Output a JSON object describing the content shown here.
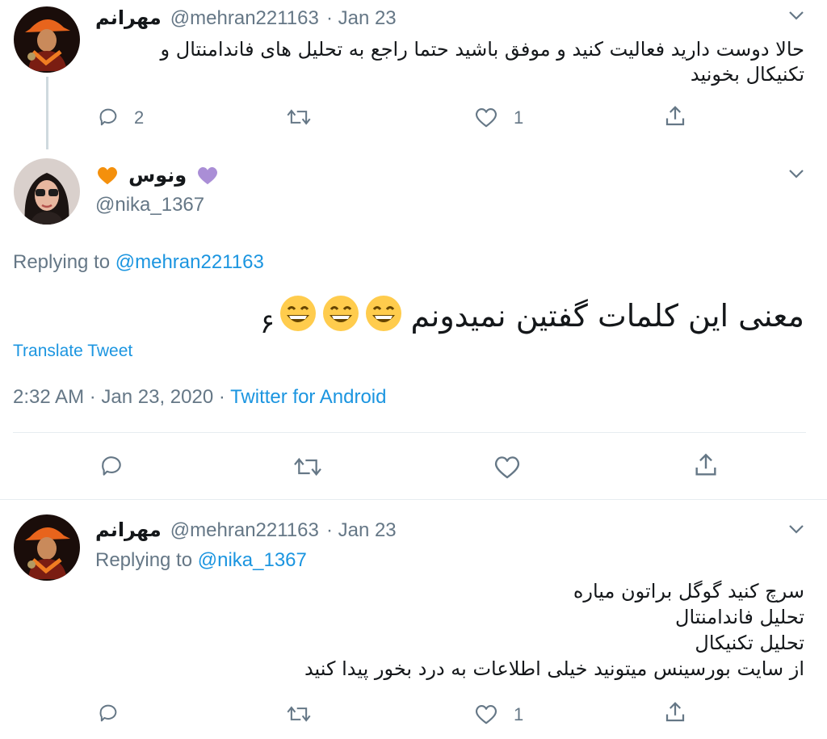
{
  "tweet1": {
    "name": "مهرانم",
    "handle": "@mehran221163",
    "date": "· Jan 23",
    "lines": [
      "حالا دوست دارید فعالیت کنید و موفق باشید حتما راجع به تحلیل های فاندامنتال و",
      "تکنیکال بخونید"
    ],
    "reply_count": "2",
    "like_count": "1"
  },
  "tweet2": {
    "name": "ونوس",
    "handle": "@nika_1367",
    "replying_prefix": "Replying to ",
    "replying_to": "@mehran221163",
    "text": "معنی این کلمات گفتین نمیدونم",
    "trailing": "۶",
    "translate": "Translate Tweet",
    "time": "2:32 AM · Jan 23, 2020 · ",
    "source": "Twitter for Android"
  },
  "tweet3": {
    "name": "مهرانم",
    "handle": "@mehran221163",
    "date": "· Jan 23",
    "replying_prefix": "Replying to ",
    "replying_to": "@nika_1367",
    "lines": [
      "سرچ کنید گوگل براتون میاره",
      "تحلیل فاندامنتال",
      "تحلیل تکنیکال",
      "از سایت بورسینس میتونید خیلی اطلاعات به درد بخور پیدا کنید"
    ],
    "like_count": "1"
  },
  "icons": [
    "chevron-down-icon",
    "reply-icon",
    "retweet-icon",
    "like-icon",
    "share-icon",
    "heart-emoji-orange",
    "heart-emoji-purple",
    "grinning-emoji"
  ],
  "colors": {
    "link": "#1b95e0",
    "muted": "#657786",
    "text": "#14171a",
    "divider": "#e6ecf0",
    "emoji_face": "#ffcc4d"
  }
}
